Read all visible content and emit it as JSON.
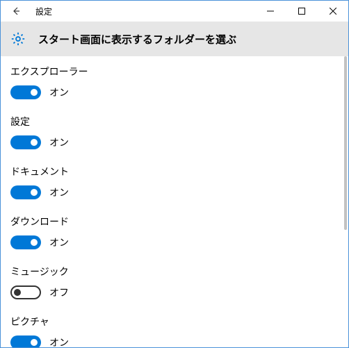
{
  "window": {
    "title": "設定"
  },
  "header": {
    "heading": "スタート画面に表示するフォルダーを選ぶ"
  },
  "labels": {
    "on": "オン",
    "off": "オフ"
  },
  "colors": {
    "accent": "#0078d7",
    "border": "#4a92d9"
  },
  "settings": [
    {
      "id": "explorer",
      "label": "エクスプローラー",
      "on": true
    },
    {
      "id": "settings",
      "label": "設定",
      "on": true
    },
    {
      "id": "documents",
      "label": "ドキュメント",
      "on": true
    },
    {
      "id": "downloads",
      "label": "ダウンロード",
      "on": true
    },
    {
      "id": "music",
      "label": "ミュージック",
      "on": false
    },
    {
      "id": "pictures",
      "label": "ピクチャ",
      "on": true
    }
  ]
}
